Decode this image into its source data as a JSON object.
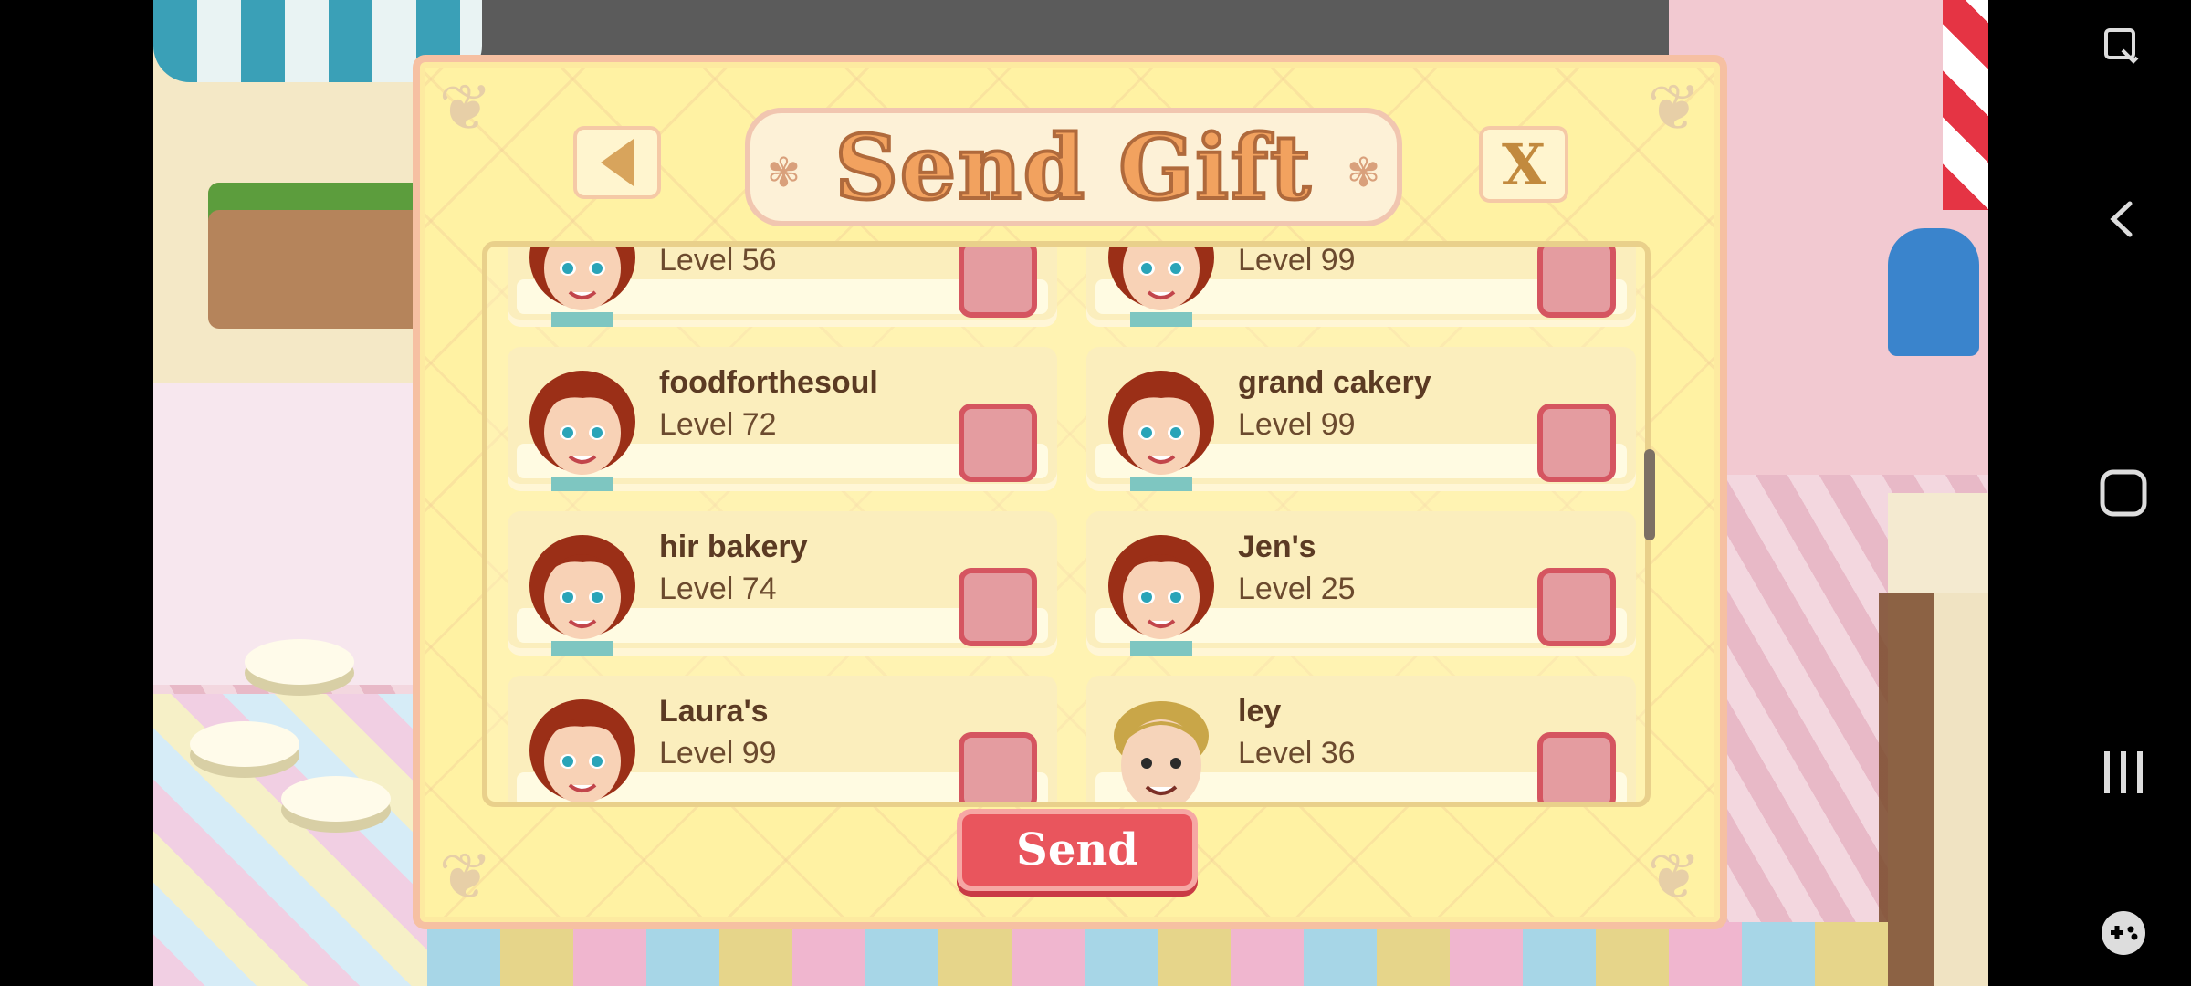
{
  "dialog": {
    "title": "Send Gift",
    "close_label": "X",
    "send_label": "Send"
  },
  "friends": [
    {
      "name": "",
      "level": "Level 56",
      "avatar": "girl-red-hair-icon",
      "checked": false
    },
    {
      "name": "",
      "level": "Level 99",
      "avatar": "girl-red-hair-icon",
      "checked": false
    },
    {
      "name": "foodforthesoul",
      "level": "Level 72",
      "avatar": "girl-red-hair-icon",
      "checked": false
    },
    {
      "name": "grand cakery",
      "level": "Level 99",
      "avatar": "girl-red-hair-icon",
      "checked": false
    },
    {
      "name": "hir bakery",
      "level": "Level 74",
      "avatar": "girl-red-hair-icon",
      "checked": false
    },
    {
      "name": "Jen's",
      "level": "Level 25",
      "avatar": "girl-red-hair-icon",
      "checked": false
    },
    {
      "name": "Laura's",
      "level": "Level 99",
      "avatar": "girl-red-hair-icon",
      "checked": false
    },
    {
      "name": "ley",
      "level": "Level 36",
      "avatar": "boy-blond-hair-icon",
      "checked": false
    }
  ],
  "colors": {
    "panel": "#fff2a3",
    "checkbox": "#e49ca0",
    "send": "#e9555d",
    "title": "#f2a25f"
  },
  "system_nav": [
    "shortcut-icon",
    "back-icon",
    "home-icon",
    "recent-apps-icon",
    "game-tools-icon"
  ]
}
